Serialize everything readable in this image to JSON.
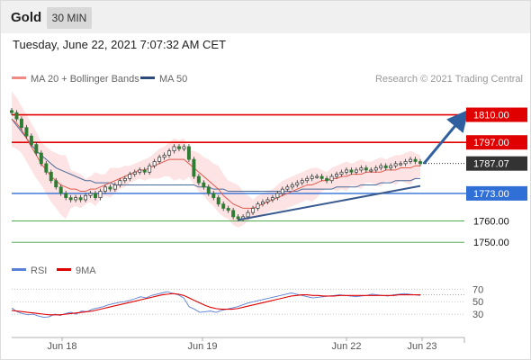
{
  "header": {
    "instrument": "Gold",
    "timeframe": "30 MIN"
  },
  "datetime": "Tuesday, June 22, 2021 7:07:32 AM CET",
  "legend": {
    "ma20": "MA 20 + Bollinger Bands",
    "ma50": "MA 50",
    "credit": "Research © 2021 Trading Central",
    "rsi": "RSI",
    "rsi_ma": "9MA"
  },
  "colors": {
    "up_candle": "#ffffff",
    "down_candle": "#2e7d32",
    "ma20": "#e05a4e",
    "bollinger_fill": "#fddede",
    "ma50": "#4a6a9a",
    "resistance": "#e00000",
    "support": "#2f6fd6",
    "target_line": "#3aa03a",
    "arrow": "#2f5f9f",
    "rsi": "#5a7fd6",
    "rsi_ma": "#e00000",
    "current_price_box": "#333333"
  },
  "chart_data": [
    {
      "type": "candlestick",
      "x_labels": [
        "Jun 18",
        "Jun 19",
        "Jun 22",
        "Jun 23"
      ],
      "ylim": [
        1745,
        1817
      ],
      "price_levels": [
        {
          "label": "1810.00",
          "value": 1810.0,
          "kind": "resistance"
        },
        {
          "label": "1797.00",
          "value": 1797.0,
          "kind": "resistance"
        },
        {
          "label": "1787.07",
          "value": 1787.07,
          "kind": "last_price"
        },
        {
          "label": "1773.00",
          "value": 1773.0,
          "kind": "support"
        },
        {
          "label": "1760.00",
          "value": 1760.0,
          "kind": "target"
        },
        {
          "label": "1750.00",
          "value": 1750.0,
          "kind": "target"
        }
      ],
      "close": [
        1811,
        1808,
        1804,
        1800,
        1796,
        1792,
        1787,
        1783,
        1779,
        1776,
        1773,
        1771,
        1770,
        1771,
        1770,
        1772,
        1773,
        1771,
        1774,
        1776,
        1775,
        1777,
        1779,
        1780,
        1782,
        1783,
        1784,
        1783,
        1786,
        1788,
        1790,
        1791,
        1793,
        1795,
        1794,
        1795,
        1789,
        1781,
        1778,
        1776,
        1773,
        1771,
        1768,
        1766,
        1765,
        1762,
        1761,
        1762,
        1764,
        1766,
        1768,
        1769,
        1770,
        1771,
        1773,
        1775,
        1776,
        1777,
        1778,
        1779,
        1780,
        1781,
        1781,
        1780,
        1779,
        1781,
        1782,
        1783,
        1784,
        1783,
        1784,
        1785,
        1784,
        1784,
        1785,
        1786,
        1785,
        1786,
        1787,
        1787,
        1788,
        1789,
        1788,
        1787
      ],
      "series": [
        {
          "name": "MA 20",
          "values": [
            1808,
            1806,
            1803,
            1799,
            1795,
            1791,
            1787,
            1784,
            1781,
            1779,
            1777,
            1776,
            1775,
            1775,
            1774,
            1774,
            1775,
            1775,
            1776,
            1777,
            1778,
            1779,
            1780,
            1781,
            1782,
            1783,
            1784,
            1784,
            1785,
            1786,
            1787,
            1788,
            1789,
            1789,
            1789,
            1789,
            1787,
            1785,
            1783,
            1781,
            1779,
            1777,
            1775,
            1772,
            1770,
            1768,
            1767,
            1766,
            1766,
            1766,
            1767,
            1768,
            1769,
            1770,
            1771,
            1772,
            1773,
            1774,
            1775,
            1776,
            1777,
            1777,
            1778,
            1779,
            1779,
            1780,
            1780,
            1781,
            1781,
            1782,
            1782,
            1782,
            1783,
            1783,
            1783,
            1783,
            1784,
            1784,
            1784,
            1785,
            1785,
            1785,
            1786,
            1786
          ]
        },
        {
          "name": "MA 50",
          "values": [
            1808,
            1805,
            1802,
            1799,
            1796,
            1793,
            1791,
            1789,
            1787,
            1785,
            1784,
            1783,
            1782,
            1781,
            1780,
            1779,
            1779,
            1778,
            1778,
            1778,
            1778,
            1777,
            1777,
            1777,
            1777,
            1777,
            1777,
            1777,
            1777,
            1777,
            1777,
            1777,
            1777,
            1777,
            1777,
            1777,
            1777,
            1777,
            1776,
            1776,
            1776,
            1775,
            1775,
            1775,
            1774,
            1774,
            1774,
            1774,
            1774,
            1774,
            1774,
            1774,
            1774,
            1774,
            1774,
            1774,
            1774,
            1774,
            1774,
            1775,
            1775,
            1775,
            1775,
            1775,
            1775,
            1775,
            1776,
            1776,
            1776,
            1776,
            1776,
            1777,
            1777,
            1777,
            1777,
            1778,
            1778,
            1778,
            1779,
            1779,
            1779,
            1779,
            1780,
            1780
          ]
        }
      ]
    },
    {
      "type": "line",
      "title": "RSI",
      "ylim": [
        10,
        82
      ],
      "y_ticks": [
        "70",
        "50",
        "30"
      ],
      "series": [
        {
          "name": "RSI",
          "values": [
            40,
            34,
            31,
            29,
            30,
            27,
            25,
            26,
            30,
            28,
            31,
            33,
            30,
            35,
            34,
            38,
            40,
            42,
            45,
            47,
            49,
            50,
            52,
            55,
            58,
            56,
            60,
            62,
            64,
            66,
            63,
            61,
            56,
            42,
            38,
            33,
            34,
            35,
            33,
            36,
            38,
            40,
            42,
            45,
            48,
            50,
            52,
            54,
            56,
            58,
            60,
            62,
            64,
            62,
            60,
            58,
            56,
            57,
            58,
            59,
            60,
            61,
            60,
            59,
            58,
            59,
            60,
            62,
            61,
            60,
            59,
            61,
            62,
            63,
            62,
            61,
            60
          ]
        },
        {
          "name": "9MA",
          "values": [
            36,
            35,
            34,
            33,
            32,
            31,
            30,
            29,
            29,
            29,
            30,
            31,
            32,
            33,
            34,
            35,
            37,
            39,
            41,
            43,
            45,
            47,
            49,
            51,
            53,
            55,
            57,
            59,
            61,
            62,
            63,
            62,
            60,
            56,
            52,
            48,
            44,
            41,
            39,
            38,
            38,
            38,
            39,
            41,
            43,
            45,
            47,
            49,
            51,
            53,
            55,
            57,
            59,
            60,
            61,
            61,
            60,
            60,
            59,
            59,
            59,
            60,
            60,
            60,
            60,
            60,
            60,
            60,
            60,
            60,
            60,
            60,
            61,
            61,
            61,
            61,
            61
          ]
        }
      ]
    }
  ]
}
